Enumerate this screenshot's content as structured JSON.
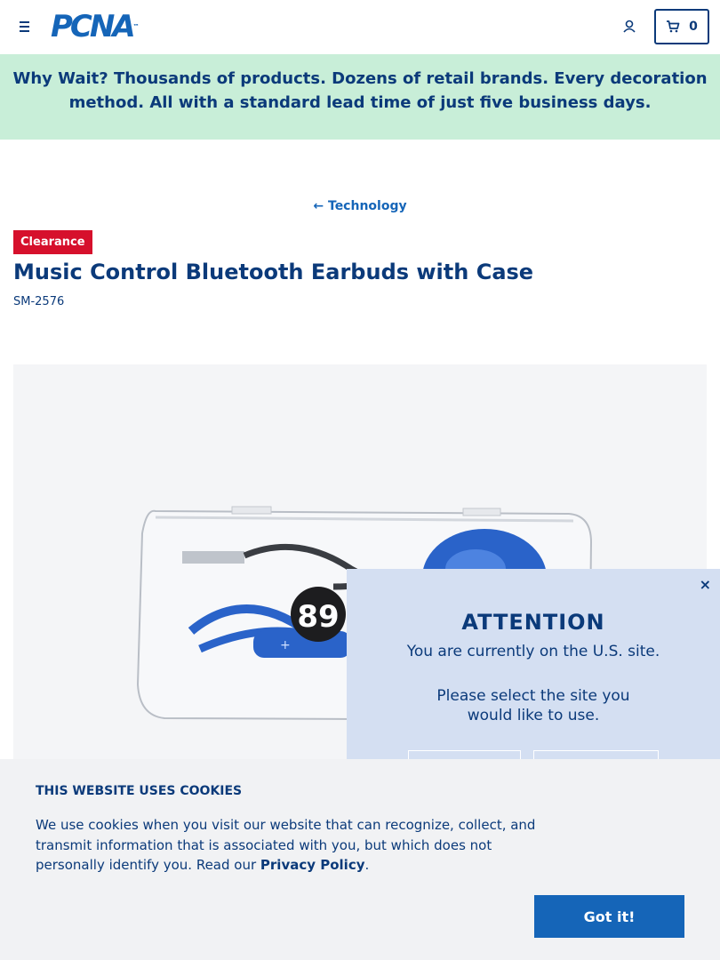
{
  "header": {
    "logo_text": "PCNA",
    "logo_tm": "™",
    "cart_count": "0"
  },
  "banner": {
    "lead": "Why Wait?",
    "text": " Thousands of products. Dozens of retail brands. Every decoration method. All with a standard lead time of just five business days."
  },
  "breadcrumb": {
    "arrow": "←",
    "label": "Technology"
  },
  "product": {
    "badge": "Clearance",
    "title": "Music Control Bluetooth Earbuds with Case",
    "sku": "SM-2576",
    "image_sticker": "89"
  },
  "attention_modal": {
    "close": "×",
    "heading": "ATTENTION",
    "line1": "You are currently on the U.S. site.",
    "line2": "Please select the site you would like to use."
  },
  "cookie_banner": {
    "title": "THIS WEBSITE USES COOKIES",
    "text": "We use cookies when you visit our website that can recognize, collect, and transmit information that is associated with you, but which does not personally identify you. Read our ",
    "link": "Privacy Policy",
    "suffix": ".",
    "button": "Got it!"
  },
  "colors": {
    "brand_blue": "#1565b8",
    "navy": "#0b3a7a",
    "banner_green": "#c8eed8",
    "clearance_red": "#d6102c",
    "modal_blue": "#d4dff2",
    "product_blue": "#2a63c9"
  }
}
